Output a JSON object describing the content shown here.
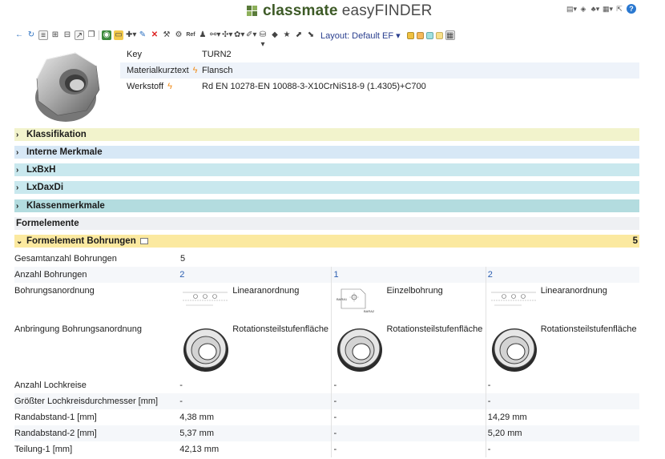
{
  "app": {
    "brand_bold": "classmate",
    "brand_light": "easyFINDER"
  },
  "header_icons": [
    "chart-icon",
    "tag-icon",
    "user-icon",
    "table-icon",
    "share-icon",
    "help-icon"
  ],
  "toolbar": {
    "layout_label": "Layout: Default EF",
    "layout_chevron": "▾"
  },
  "item": {
    "rows": [
      {
        "key": "Key",
        "value": "TURN2"
      },
      {
        "key": "Materialkurztext",
        "value": "Flansch"
      },
      {
        "key": "Werkstoff",
        "value": "Rd EN 10278-EN 10088-3-X10CrNiS18-9 (1.4305)+C700"
      }
    ]
  },
  "sections": [
    {
      "label": "Klassifikation",
      "color": "#f2f3cc"
    },
    {
      "label": "Interne Merkmale",
      "color": "#d7e8f6"
    },
    {
      "label": "LxBxH",
      "color": "#c9e8ee"
    },
    {
      "label": "LxDaxDi",
      "color": "#c9e8ee"
    },
    {
      "label": "Klassenmerkmale",
      "color": "#b3dcdf"
    },
    {
      "label": "Formelemente",
      "color": "#eef0f3"
    },
    {
      "label": "Formelement Bohrungen",
      "count": "5",
      "color": "#fbe9a0"
    }
  ],
  "table": {
    "gesamt": {
      "label": "Gesamtanzahl Bohrungen",
      "value": "5"
    },
    "anzahl": {
      "label": "Anzahl Bohrungen",
      "values": [
        "2",
        "1",
        "2"
      ]
    },
    "anordnung": {
      "label": "Bohrungsanordnung",
      "values": [
        "Linearanordnung",
        "Einzelbohrung",
        "Linearanordnung"
      ]
    },
    "anbringung": {
      "label": "Anbringung Bohrungsanordnung",
      "values": [
        "Rotationsteilstufenfläche",
        "Rotationsteilstufenfläche",
        "Rotationsteilstufenfläche"
      ]
    },
    "lochkreise": {
      "label": "Anzahl Lochkreise",
      "values": [
        "-",
        "-",
        "-"
      ]
    },
    "lkd": {
      "label": "Größter Lochkreisdurchmesser [mm]",
      "values": [
        "-",
        "-",
        "-"
      ]
    },
    "rand1": {
      "label": "Randabstand-1 [mm]",
      "values": [
        "4,38 mm",
        "-",
        "14,29 mm"
      ]
    },
    "rand2": {
      "label": "Randabstand-2 [mm]",
      "values": [
        "5,37 mm",
        "-",
        "5,20 mm"
      ]
    },
    "teilung": {
      "label": "Teilung-1 [mm]",
      "values": [
        "42,13 mm",
        "-",
        "-"
      ]
    }
  },
  "sketch_labels": {
    "bara1": "BARA1",
    "bara2": "BARA2"
  }
}
